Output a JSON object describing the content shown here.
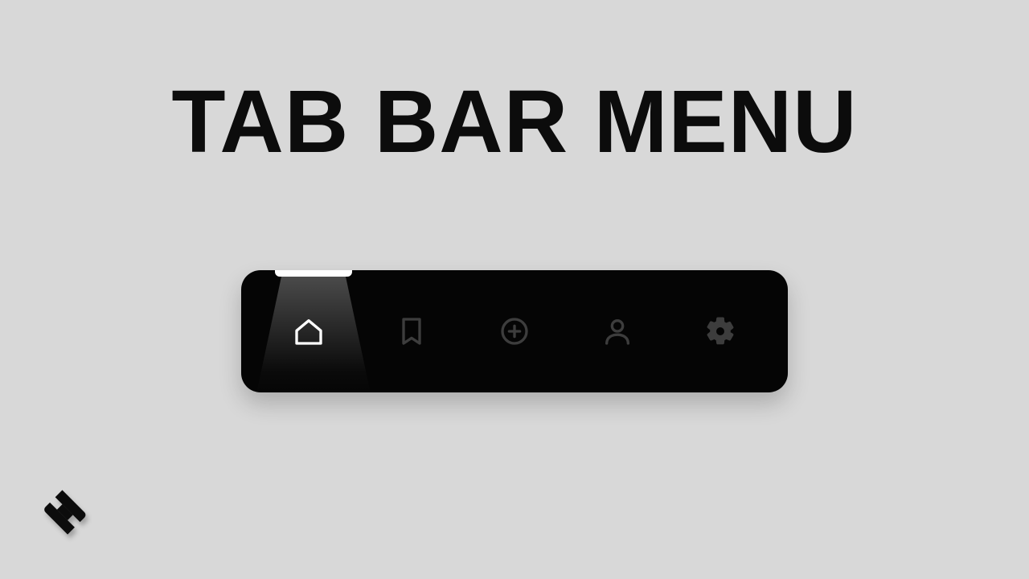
{
  "heading": "TAB BAR MENU",
  "colors": {
    "page_bg": "#d8d8d8",
    "bar_bg": "#050505",
    "active_icon": "#ffffff",
    "inactive_icon": "#3d3d3d",
    "text": "#0c0c0c"
  },
  "active_tab_index": 0,
  "tabs": [
    {
      "icon_name": "home-icon"
    },
    {
      "icon_name": "bookmark-icon"
    },
    {
      "icon_name": "plus-circle-icon"
    },
    {
      "icon_name": "user-icon"
    },
    {
      "icon_name": "gear-icon"
    }
  ],
  "brand_icon": "brand-logo"
}
